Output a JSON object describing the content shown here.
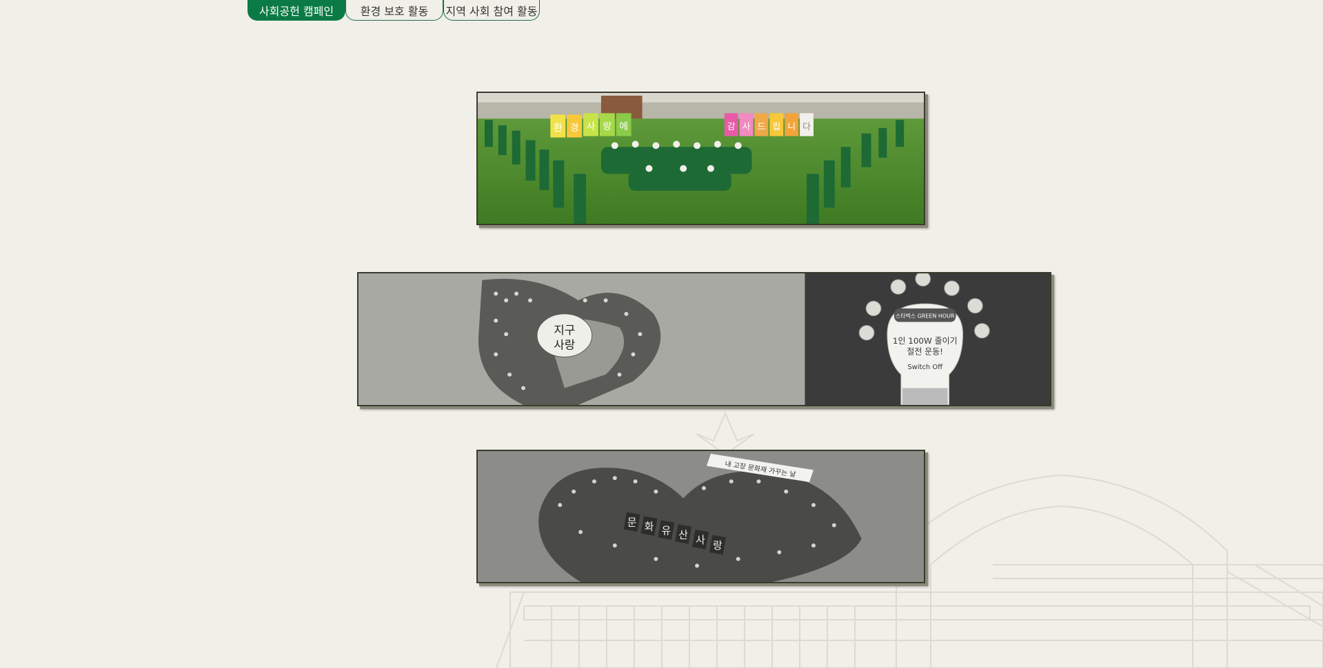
{
  "tabs": [
    {
      "label": "사회공헌 캠페인",
      "active": true
    },
    {
      "label": "환경 보호 활동",
      "active": false
    },
    {
      "label": "지역 사회 참여 활동",
      "active": false
    }
  ],
  "photos": [
    {
      "signs_left": [
        "환",
        "경",
        "사",
        "랑",
        "에"
      ],
      "signs_right": [
        "감",
        "사",
        "드",
        "립",
        "니",
        "다"
      ]
    },
    {
      "earth_sign": [
        "지구",
        "사랑"
      ],
      "bulb_header": "스타벅스 GREEN HOUR",
      "bulb_line1": "1인 100W 줄이기",
      "bulb_line2": "절전 운동!",
      "bulb_switch": "Switch Off"
    },
    {
      "banner": "내 고장 문화재 가꾸는 날",
      "heritage_signs": [
        "문",
        "화",
        "유",
        "산",
        "사",
        "랑"
      ]
    }
  ],
  "colors": {
    "accent": "#0c7a44",
    "page_bg": "#f0efe8",
    "lawn": "#4f8a2e"
  }
}
